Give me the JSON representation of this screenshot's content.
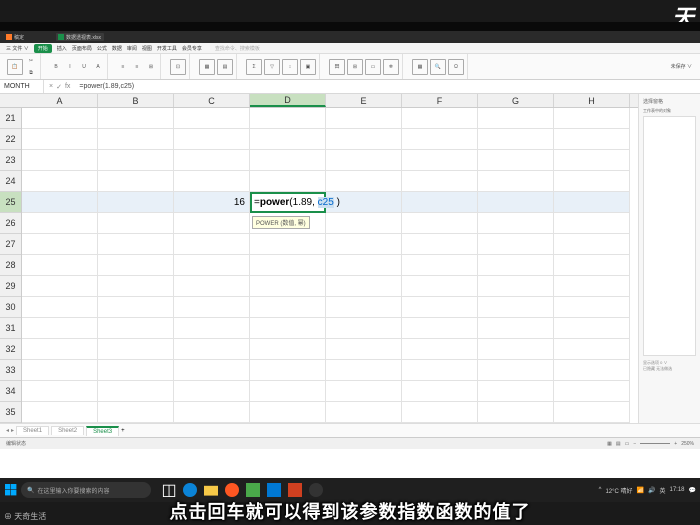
{
  "topright_brand": "天",
  "filetabs": [
    {
      "label": "稿定",
      "color": "#ff7a29"
    },
    {
      "label": "数据透视表.xlsx",
      "color": "#1a8f4a"
    }
  ],
  "menubar": {
    "items": [
      "三 文件 ∨",
      "开始",
      "插入",
      "页面布局",
      "公式",
      "数据",
      "审阅",
      "视图",
      "开发工具",
      "会员专享"
    ],
    "active_index": 1,
    "search_hint": "查找命令、搜索模板"
  },
  "ribbon": {
    "labels": [
      "粘贴",
      "剪切",
      "复制",
      "格式刷",
      "合并居中",
      "自动换行",
      "条件格式",
      "表格样式",
      "求和",
      "筛选",
      "排序",
      "填充",
      "单元格",
      "行和列",
      "工作表",
      "冻结窗格",
      "表格工具",
      "查找",
      "符号"
    ],
    "right": "未保存 ∨"
  },
  "formula_bar": {
    "name_box": "MONTH",
    "fx_symbols": [
      "×",
      "✓",
      "fx"
    ],
    "formula_text": "=power(1.89,c25)"
  },
  "columns": [
    "A",
    "B",
    "C",
    "D",
    "E",
    "F",
    "G",
    "H"
  ],
  "active_col": "D",
  "visible_rows": [
    21,
    22,
    23,
    24,
    25,
    26,
    27,
    28,
    29,
    30,
    31,
    32,
    33,
    34,
    35
  ],
  "active_row": 25,
  "cells": {
    "C25": "16",
    "D25": {
      "prefix": "=",
      "fn": "power",
      "open": "(",
      "arg1": "1.89",
      "sep": ",",
      "arg2": "c25",
      "close": ")"
    }
  },
  "tooltip": "POWER (数值, 幂)",
  "sidepanel": {
    "title": "选择窗格",
    "subtitle": "工作表中的对象",
    "box1": "显示选项  0 ∨",
    "box2": "已隐藏  无法做选"
  },
  "sheets": {
    "items": [
      "Sheet1",
      "Sheet2",
      "Sheet3"
    ],
    "active": 2,
    "add": "+"
  },
  "statusbar": {
    "left": "编辑状态",
    "zoom": "250%"
  },
  "taskbar": {
    "search_placeholder": "在这里输入你要搜索的内容",
    "weather": "12°C 晴好",
    "time": "17:18"
  },
  "subtitle": "点击回车就可以得到该参数指数函数的值了",
  "watermark": "⊕ 天奇生活"
}
